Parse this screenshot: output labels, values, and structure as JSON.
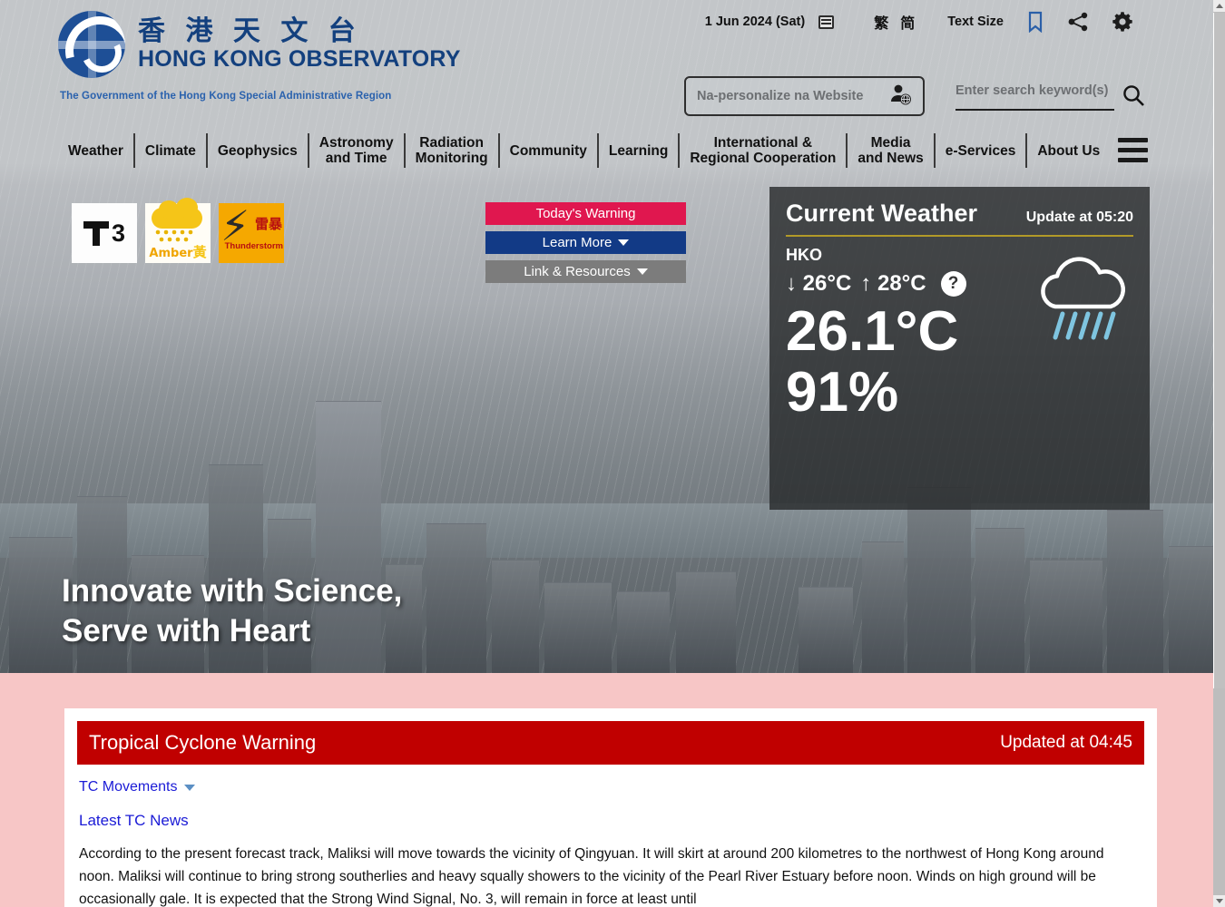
{
  "header": {
    "logo_cn": "香 港 天 文 台",
    "logo_en": "HONG KONG OBSERVATORY",
    "gov_line": "The Government of the Hong Kong Special Administrative Region",
    "date": "1 Jun 2024 (Sat)",
    "lang_trad": "繁",
    "lang_simp": "简",
    "text_size": "Text Size",
    "icons": {
      "calendar": "calendar-icon",
      "bookmark": "bookmark-icon",
      "share": "share-icon",
      "settings": "gear-icon"
    }
  },
  "personalize": {
    "placeholder": "Na-personalize na Website",
    "icon": "person-globe-icon"
  },
  "search": {
    "placeholder": "Enter search keyword(s)",
    "icon": "search-icon"
  },
  "nav": {
    "items": [
      {
        "label": "Weather"
      },
      {
        "label": "Climate"
      },
      {
        "label": "Geophysics"
      },
      {
        "label": "Astronomy\nand Time"
      },
      {
        "label": "Radiation\nMonitoring"
      },
      {
        "label": "Community"
      },
      {
        "label": "Learning"
      },
      {
        "label": "International &\nRegional Cooperation"
      },
      {
        "label": "Media\nand News"
      },
      {
        "label": "e-Services"
      },
      {
        "label": "About Us"
      }
    ],
    "menu_icon": "hamburger-menu-icon"
  },
  "warnings": {
    "signal_number": "3",
    "amber_en": "Amber",
    "amber_cn": "黃",
    "thunder_cn": "雷暴",
    "thunder_en": "Thunderstorm"
  },
  "hero_buttons": {
    "todays_warning": "Today's Warning",
    "learn_more": "Learn More",
    "link_resources": "Link & Resources"
  },
  "current_weather": {
    "title": "Current Weather",
    "update": "Update at 05:20",
    "station": "HKO",
    "min_temp": "↓ 26°C",
    "max_temp": "↑ 28°C",
    "help": "?",
    "temperature": "26.1°C",
    "humidity": "91%",
    "icon": "rain-cloud-icon"
  },
  "tagline": "Innovate with Science,\nServe with Heart",
  "tropical_cyclone": {
    "title": "Tropical Cyclone Warning",
    "updated": "Updated at 04:45",
    "tc_movements": "TC Movements",
    "latest_tc_news": "Latest TC News",
    "body": "According to the present forecast track, Maliksi will move towards the vicinity of Qingyuan. It will skirt at around 200 kilometres to the northwest of Hong Kong around noon. Maliksi will continue to bring strong southerlies and heavy squally showers to the vicinity of the Pearl River Estuary before noon. Winds on high ground will be occasionally gale. It is expected that the Strong Wind Signal, No. 3, will remain in force at least until"
  },
  "colors": {
    "brand_blue": "#13407e",
    "warning_red": "#e0174f",
    "learn_blue": "#123a86",
    "link_gray": "#7c7c7c",
    "tc_bar_red": "#c00000",
    "pink_bg": "#f7c6c6",
    "link_text": "#1b1bd6",
    "gold_rule": "#b29a28"
  }
}
